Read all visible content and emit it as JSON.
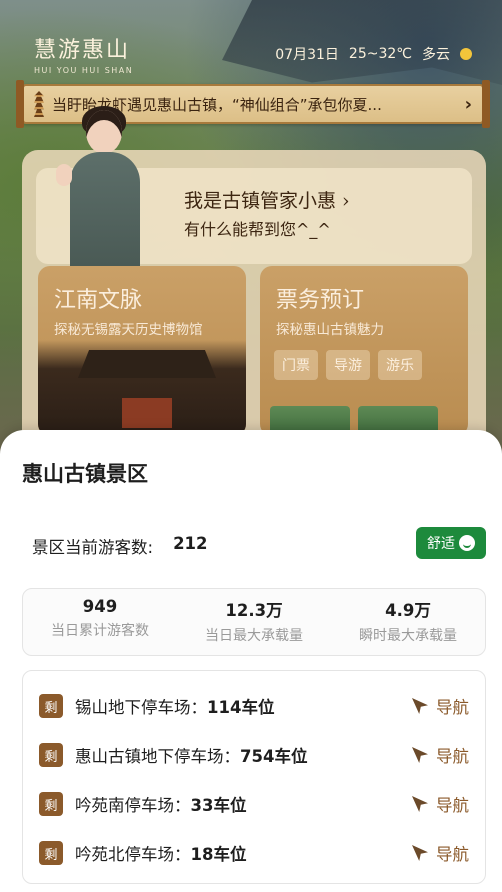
{
  "header": {
    "logo_cn": "慧游惠山",
    "logo_en": "HUI YOU HUI SHAN",
    "date": "07月31日",
    "temperature": "25~32℃",
    "weather": "多云"
  },
  "banner": {
    "text": "当盱眙龙虾遇见惠山古镇，“神仙组合”承包你夏..."
  },
  "guide": {
    "title": "我是古镇管家小惠 ›",
    "subtitle": "有什么能帮到您^_^"
  },
  "tiles": {
    "left": {
      "title": "江南文脉",
      "subtitle": "探秘无锡露天历史博物馆"
    },
    "right": {
      "title": "票务预订",
      "subtitle": "探秘惠山古镇魅力",
      "chips": [
        "门票",
        "导游",
        "游乐"
      ]
    }
  },
  "sheet": {
    "title": "惠山古镇景区",
    "visitors_label": "景区当前游客数:",
    "visitors_value": "212",
    "comfort_label": "舒适",
    "stats": [
      {
        "value": "949",
        "label": "当日累计游客数"
      },
      {
        "value": "12.3万",
        "label": "当日最大承载量"
      },
      {
        "value": "4.9万",
        "label": "瞬时最大承载量"
      }
    ],
    "parking": [
      {
        "badge": "剩",
        "name": "锡山地下停车场：",
        "count": "114车位",
        "nav": "导航"
      },
      {
        "badge": "剩",
        "name": "惠山古镇地下停车场：",
        "count": "754车位",
        "nav": "导航"
      },
      {
        "badge": "剩",
        "name": "吟苑南停车场：",
        "count": "33车位",
        "nav": "导航"
      },
      {
        "badge": "剩",
        "name": "吟苑北停车场：",
        "count": "18车位",
        "nav": "导航"
      }
    ]
  },
  "colors": {
    "accent_brown": "#8b5a2b",
    "comfort_green": "#1d8a3c"
  }
}
